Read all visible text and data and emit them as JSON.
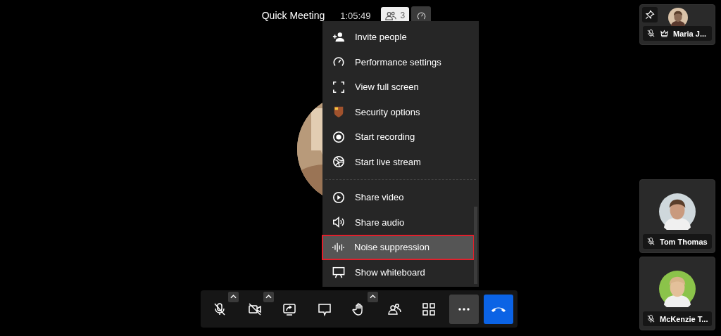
{
  "meeting": {
    "title": "Quick Meeting",
    "duration": "1:05:49",
    "participant_count": "3"
  },
  "menu": {
    "sections": [
      [
        {
          "label": "Invite people",
          "selected": false
        },
        {
          "label": "Performance settings",
          "selected": false
        },
        {
          "label": "View full screen",
          "selected": false
        },
        {
          "label": "Security options",
          "selected": false
        },
        {
          "label": "Start recording",
          "selected": false
        },
        {
          "label": "Start live stream",
          "selected": false
        }
      ],
      [
        {
          "label": "Share video",
          "selected": false
        },
        {
          "label": "Share audio",
          "selected": false
        },
        {
          "label": "Noise suppression",
          "selected": true
        },
        {
          "label": "Show whiteboard",
          "selected": false
        }
      ]
    ]
  },
  "participants": [
    {
      "name": "Maria J...",
      "muted": true,
      "host": true,
      "pinned": true
    },
    {
      "name": "Tom Thomas",
      "muted": true,
      "host": false,
      "pinned": false
    },
    {
      "name": "McKenzie T...",
      "muted": true,
      "host": false,
      "pinned": false
    }
  ],
  "toolbar": {
    "buttons": [
      {
        "kind": "mic",
        "muted": true,
        "caret": true,
        "selected": false
      },
      {
        "kind": "camera",
        "muted": true,
        "caret": true,
        "selected": false
      },
      {
        "kind": "share",
        "caret": false,
        "selected": false
      },
      {
        "kind": "chat",
        "caret": false,
        "selected": false
      },
      {
        "kind": "hand",
        "caret": true,
        "selected": false
      },
      {
        "kind": "people",
        "caret": false,
        "selected": false
      },
      {
        "kind": "grid",
        "caret": false,
        "selected": false
      },
      {
        "kind": "more",
        "caret": false,
        "selected": true
      },
      {
        "kind": "hangup",
        "caret": false,
        "selected": false
      }
    ]
  }
}
